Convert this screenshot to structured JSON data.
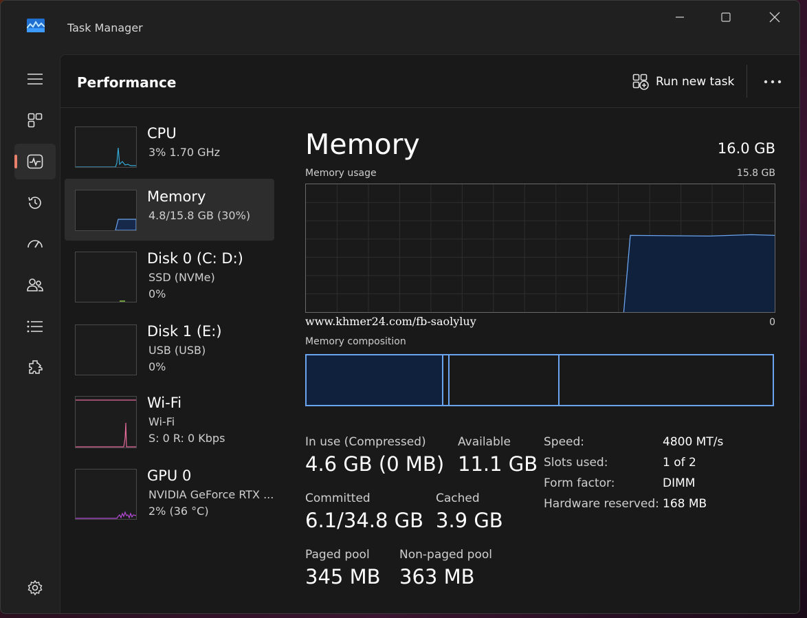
{
  "app": {
    "title": "Task Manager"
  },
  "header": {
    "page_title": "Performance",
    "run_new_task_label": "Run new task"
  },
  "nav": {
    "icons": [
      "hamburger-icon",
      "processes-icon",
      "performance-icon",
      "app-history-icon",
      "startup-apps-icon",
      "users-icon",
      "details-icon",
      "services-icon",
      "settings-icon"
    ],
    "active": "performance-icon"
  },
  "sidebar": {
    "items": [
      {
        "name": "CPU",
        "sub1": "3%  1.70 GHz",
        "sub2": "",
        "graph_color": "#35a9d6"
      },
      {
        "name": "Memory",
        "sub1": "4.8/15.8 GB (30%)",
        "sub2": "",
        "graph_color": "#6ba4ef"
      },
      {
        "name": "Disk 0 (C: D:)",
        "sub1": "SSD (NVMe)",
        "sub2": "0%",
        "graph_color": "#8bc34a"
      },
      {
        "name": "Disk 1 (E:)",
        "sub1": "USB (USB)",
        "sub2": "0%",
        "graph_color": "#8bc34a"
      },
      {
        "name": "Wi-Fi",
        "sub1": "Wi-Fi",
        "sub2": "S: 0  R: 0 Kbps",
        "graph_color": "#e46a9a"
      },
      {
        "name": "GPU 0",
        "sub1": "NVIDIA GeForce RTX ...",
        "sub2": "2%  (36 °C)",
        "graph_color": "#b44ad6"
      }
    ],
    "selected": 1
  },
  "memory": {
    "title": "Memory",
    "total": "16.0 GB",
    "usage_label": "Memory usage",
    "usage_max": "15.8 GB",
    "axis_right": "0",
    "watermark": "www.khmer24.com/fb-saolyluy",
    "composition_label": "Memory composition",
    "usage_fraction": 0.3,
    "accent_color": "#6ba4ef",
    "stats": {
      "in_use_label": "In use (Compressed)",
      "in_use_value": "4.6 GB (0 MB)",
      "available_label": "Available",
      "available_value": "11.1 GB",
      "committed_label": "Committed",
      "committed_value": "6.1/34.8 GB",
      "cached_label": "Cached",
      "cached_value": "3.9 GB",
      "paged_label": "Paged pool",
      "paged_value": "345 MB",
      "nonpaged_label": "Non-paged pool",
      "nonpaged_value": "363 MB"
    },
    "specs": [
      {
        "label": "Speed:",
        "value": "4800 MT/s"
      },
      {
        "label": "Slots used:",
        "value": "1 of 2"
      },
      {
        "label": "Form factor:",
        "value": "DIMM"
      },
      {
        "label": "Hardware reserved:",
        "value": "168 MB"
      }
    ]
  }
}
